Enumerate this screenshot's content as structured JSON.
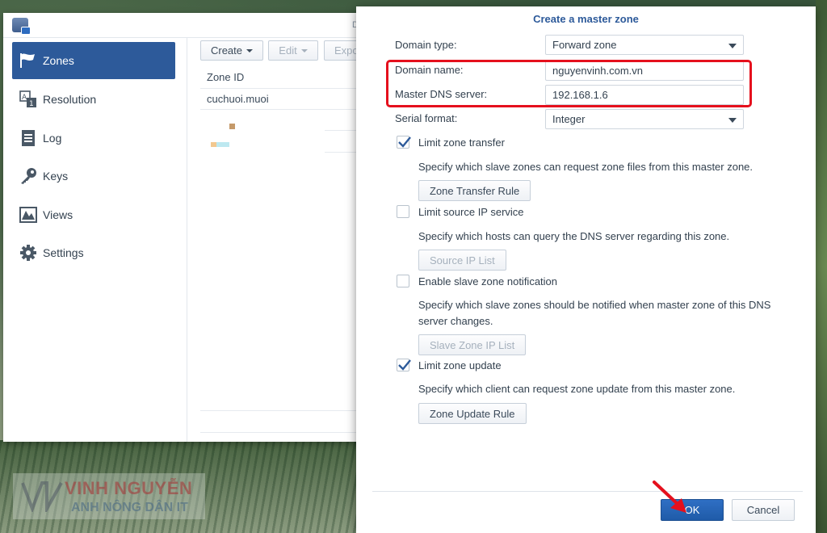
{
  "main_window": {
    "title_fragment": "D",
    "sidebar": [
      {
        "label": "Zones",
        "icon": "flag-icon",
        "active": true
      },
      {
        "label": "Resolution",
        "icon": "resolution-icon",
        "active": false
      },
      {
        "label": "Log",
        "icon": "log-icon",
        "active": false
      },
      {
        "label": "Keys",
        "icon": "key-icon",
        "active": false
      },
      {
        "label": "Views",
        "icon": "views-icon",
        "active": false
      },
      {
        "label": "Settings",
        "icon": "gear-icon",
        "active": false
      }
    ],
    "toolbar": {
      "create_label": "Create",
      "edit_label": "Edit",
      "export_label": "Expo"
    },
    "table": {
      "column_header": "Zone ID",
      "rows": [
        "cuchuoi.muoi"
      ]
    }
  },
  "dialog": {
    "title": "Create a master zone",
    "domain_type": {
      "label": "Domain type:",
      "value": "Forward zone"
    },
    "domain_name": {
      "label": "Domain name:",
      "value": "nguyenvinh.com.vn"
    },
    "master_dns": {
      "label": "Master DNS server:",
      "value": "192.168.1.6"
    },
    "serial_format": {
      "label": "Serial format:",
      "value": "Integer"
    },
    "options": [
      {
        "label": "Limit zone transfer",
        "checked": true,
        "description": "Specify which slave zones can request zone files from this master zone.",
        "button": "Zone Transfer Rule",
        "button_enabled": true
      },
      {
        "label": "Limit source IP service",
        "checked": false,
        "description": "Specify which hosts can query the DNS server regarding this zone.",
        "button": "Source IP List",
        "button_enabled": false
      },
      {
        "label": "Enable slave zone notification",
        "checked": false,
        "description": "Specify which slave zones should be notified when master zone of this DNS server changes.",
        "button": "Slave Zone IP List",
        "button_enabled": false
      },
      {
        "label": "Limit zone update",
        "checked": true,
        "description": "Specify which client can request zone update from this master zone.",
        "button": "Zone Update Rule",
        "button_enabled": true
      }
    ],
    "ok_label": "OK",
    "cancel_label": "Cancel"
  },
  "watermark": {
    "line1": "VINH NGUYỄN",
    "line2": "ANH NÔNG DÂN IT"
  },
  "colors": {
    "accent": "#2d5a9a",
    "highlight_red": "#e5101d",
    "ok_button": "#2466b8"
  }
}
